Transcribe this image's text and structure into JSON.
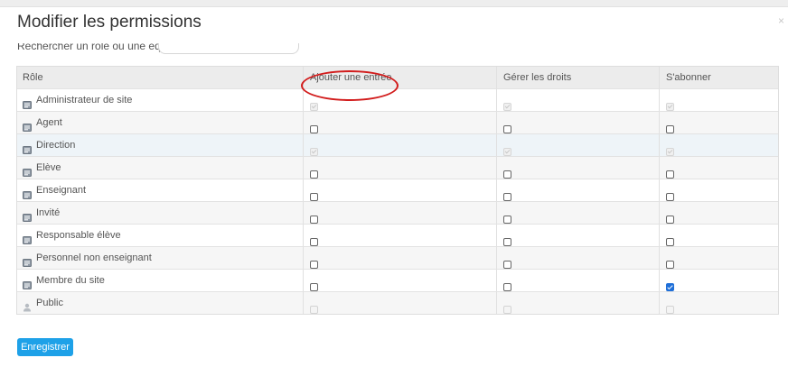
{
  "modal": {
    "title": "Modifier les permissions",
    "close_label": "×"
  },
  "search": {
    "label": "Rechercher un rôle ou une équipe :",
    "value": "",
    "placeholder": ""
  },
  "table": {
    "headers": [
      "Rôle",
      "Ajouter une entrée",
      "Gérer les droits",
      "S'abonner"
    ],
    "rows": [
      {
        "role": "Administrateur de site",
        "icon": "group-icon",
        "add": "disabled-checked",
        "manage": "disabled-checked",
        "subscribe": "disabled-checked"
      },
      {
        "role": "Agent",
        "icon": "group-icon",
        "add": "unchecked",
        "manage": "unchecked",
        "subscribe": "unchecked"
      },
      {
        "role": "Direction",
        "icon": "group-icon",
        "add": "disabled-checked",
        "manage": "disabled-checked",
        "subscribe": "disabled-checked"
      },
      {
        "role": "Elève",
        "icon": "group-icon",
        "add": "unchecked",
        "manage": "unchecked",
        "subscribe": "unchecked"
      },
      {
        "role": "Enseignant",
        "icon": "group-icon",
        "add": "unchecked",
        "manage": "unchecked",
        "subscribe": "unchecked"
      },
      {
        "role": "Invité",
        "icon": "group-icon",
        "add": "unchecked",
        "manage": "unchecked",
        "subscribe": "unchecked"
      },
      {
        "role": "Responsable élève",
        "icon": "group-icon",
        "add": "unchecked",
        "manage": "unchecked",
        "subscribe": "unchecked"
      },
      {
        "role": "Personnel non enseignant",
        "icon": "group-icon",
        "add": "unchecked",
        "manage": "unchecked",
        "subscribe": "unchecked"
      },
      {
        "role": "Membre du site",
        "icon": "group-icon",
        "add": "unchecked",
        "manage": "unchecked",
        "subscribe": "checked"
      },
      {
        "role": "Public",
        "icon": "person-icon",
        "add": "disabled",
        "manage": "disabled",
        "subscribe": "disabled"
      }
    ]
  },
  "annotation": {
    "highlight": "red-ellipse around Ajouter une entrée",
    "color": "#d21c1c"
  },
  "footer": {
    "save_label": "Enregistrer"
  },
  "colors": {
    "accent": "#1ea1e8",
    "checkbox_checked": "#1f6fd8",
    "header_bg": "#ececec"
  }
}
